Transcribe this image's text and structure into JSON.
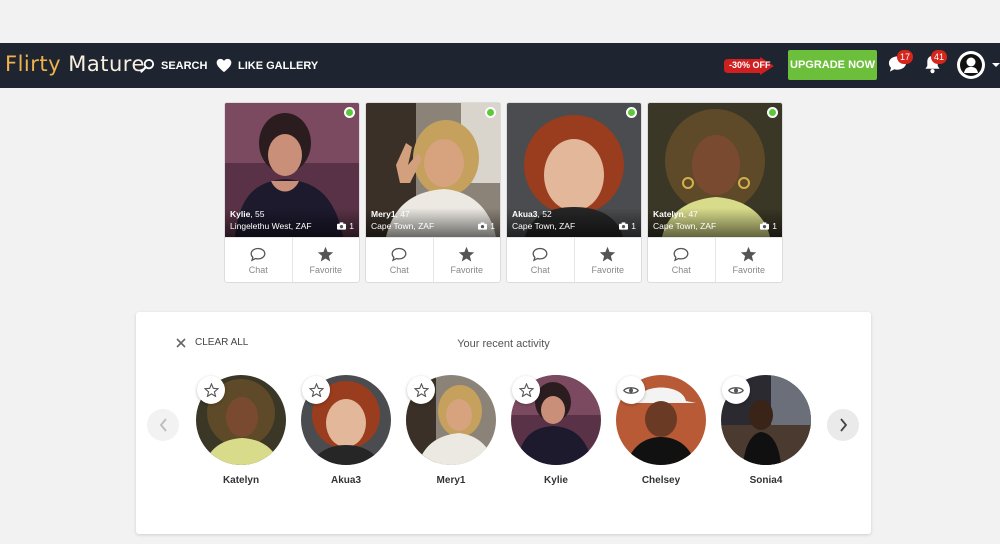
{
  "brand": {
    "word1": "Flirty",
    "word2": "Mature"
  },
  "nav": {
    "search": "SEARCH",
    "like_gallery": "LIKE GALLERY",
    "discount": "-30% OFF",
    "upgrade": "UPGRADE NOW",
    "messages_count": "17",
    "notifications_count": "41"
  },
  "colors": {
    "navbar": "#1e2530",
    "upgrade": "#6bbf3a",
    "badge": "#d6261c",
    "online": "#5cc93a"
  },
  "profiles": [
    {
      "name": "Kylie",
      "age": ", 55",
      "location": "Lingelethu West, ZAF",
      "photos": "1",
      "chat": "Chat",
      "favorite": "Favorite"
    },
    {
      "name": "Mery1",
      "age": ", 47",
      "location": "Cape Town, ZAF",
      "photos": "1",
      "chat": "Chat",
      "favorite": "Favorite"
    },
    {
      "name": "Akua3",
      "age": ", 52",
      "location": "Cape Town, ZAF",
      "photos": "1",
      "chat": "Chat",
      "favorite": "Favorite"
    },
    {
      "name": "Katelyn",
      "age": ", 47",
      "location": "Cape Town, ZAF",
      "photos": "1",
      "chat": "Chat",
      "favorite": "Favorite"
    }
  ],
  "activity": {
    "clear_all": "CLEAR ALL",
    "title": "Your recent activity",
    "people": [
      {
        "name": "Katelyn",
        "icon": "star-icon"
      },
      {
        "name": "Akua3",
        "icon": "star-icon"
      },
      {
        "name": "Mery1",
        "icon": "star-icon"
      },
      {
        "name": "Kylie",
        "icon": "star-icon"
      },
      {
        "name": "Chelsey",
        "icon": "eye-icon"
      },
      {
        "name": "Sonia4",
        "icon": "eye-icon"
      }
    ]
  }
}
